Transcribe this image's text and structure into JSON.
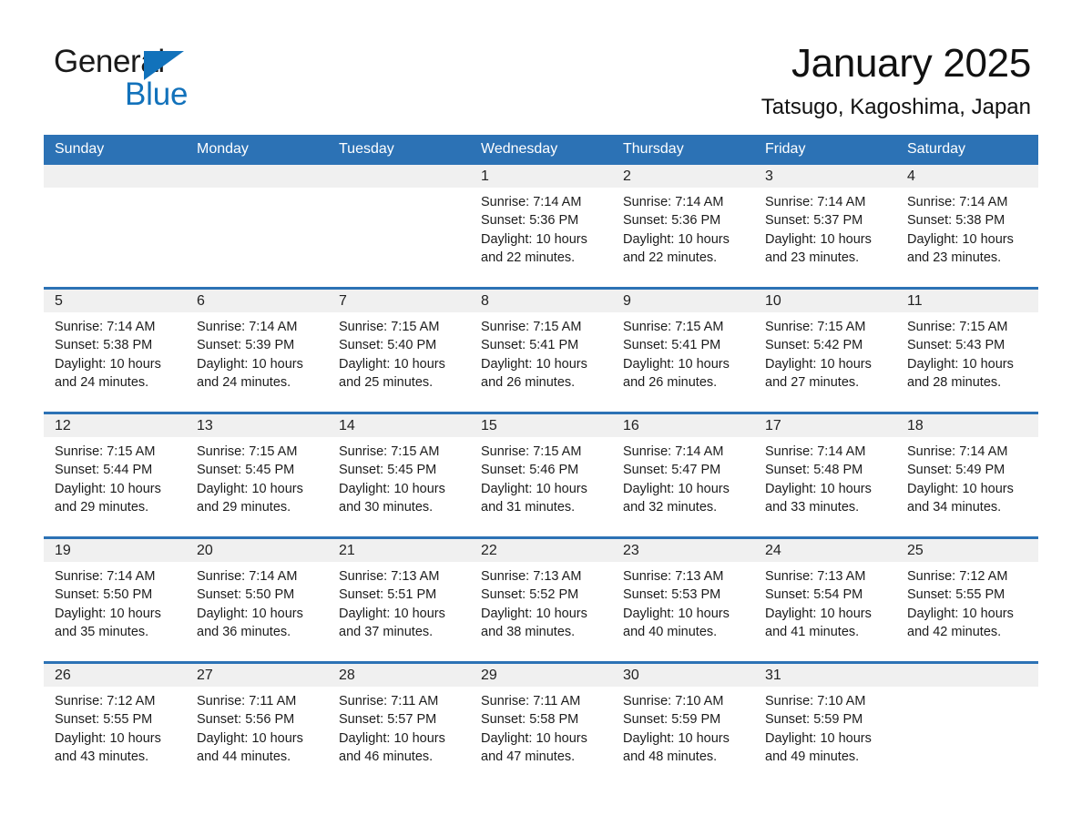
{
  "brand": {
    "word_one": "General",
    "word_two": "Blue",
    "accent_color": "#1272bb"
  },
  "header": {
    "month_title": "January 2025",
    "location": "Tatsugo, Kagoshima, Japan",
    "header_bg": "#2c72b5"
  },
  "weekday_headers": [
    "Sunday",
    "Monday",
    "Tuesday",
    "Wednesday",
    "Thursday",
    "Friday",
    "Saturday"
  ],
  "weeks": [
    [
      {
        "day": "",
        "details": ""
      },
      {
        "day": "",
        "details": ""
      },
      {
        "day": "",
        "details": ""
      },
      {
        "day": "1",
        "details": "Sunrise: 7:14 AM\nSunset: 5:36 PM\nDaylight: 10 hours\nand 22 minutes."
      },
      {
        "day": "2",
        "details": "Sunrise: 7:14 AM\nSunset: 5:36 PM\nDaylight: 10 hours\nand 22 minutes."
      },
      {
        "day": "3",
        "details": "Sunrise: 7:14 AM\nSunset: 5:37 PM\nDaylight: 10 hours\nand 23 minutes."
      },
      {
        "day": "4",
        "details": "Sunrise: 7:14 AM\nSunset: 5:38 PM\nDaylight: 10 hours\nand 23 minutes."
      }
    ],
    [
      {
        "day": "5",
        "details": "Sunrise: 7:14 AM\nSunset: 5:38 PM\nDaylight: 10 hours\nand 24 minutes."
      },
      {
        "day": "6",
        "details": "Sunrise: 7:14 AM\nSunset: 5:39 PM\nDaylight: 10 hours\nand 24 minutes."
      },
      {
        "day": "7",
        "details": "Sunrise: 7:15 AM\nSunset: 5:40 PM\nDaylight: 10 hours\nand 25 minutes."
      },
      {
        "day": "8",
        "details": "Sunrise: 7:15 AM\nSunset: 5:41 PM\nDaylight: 10 hours\nand 26 minutes."
      },
      {
        "day": "9",
        "details": "Sunrise: 7:15 AM\nSunset: 5:41 PM\nDaylight: 10 hours\nand 26 minutes."
      },
      {
        "day": "10",
        "details": "Sunrise: 7:15 AM\nSunset: 5:42 PM\nDaylight: 10 hours\nand 27 minutes."
      },
      {
        "day": "11",
        "details": "Sunrise: 7:15 AM\nSunset: 5:43 PM\nDaylight: 10 hours\nand 28 minutes."
      }
    ],
    [
      {
        "day": "12",
        "details": "Sunrise: 7:15 AM\nSunset: 5:44 PM\nDaylight: 10 hours\nand 29 minutes."
      },
      {
        "day": "13",
        "details": "Sunrise: 7:15 AM\nSunset: 5:45 PM\nDaylight: 10 hours\nand 29 minutes."
      },
      {
        "day": "14",
        "details": "Sunrise: 7:15 AM\nSunset: 5:45 PM\nDaylight: 10 hours\nand 30 minutes."
      },
      {
        "day": "15",
        "details": "Sunrise: 7:15 AM\nSunset: 5:46 PM\nDaylight: 10 hours\nand 31 minutes."
      },
      {
        "day": "16",
        "details": "Sunrise: 7:14 AM\nSunset: 5:47 PM\nDaylight: 10 hours\nand 32 minutes."
      },
      {
        "day": "17",
        "details": "Sunrise: 7:14 AM\nSunset: 5:48 PM\nDaylight: 10 hours\nand 33 minutes."
      },
      {
        "day": "18",
        "details": "Sunrise: 7:14 AM\nSunset: 5:49 PM\nDaylight: 10 hours\nand 34 minutes."
      }
    ],
    [
      {
        "day": "19",
        "details": "Sunrise: 7:14 AM\nSunset: 5:50 PM\nDaylight: 10 hours\nand 35 minutes."
      },
      {
        "day": "20",
        "details": "Sunrise: 7:14 AM\nSunset: 5:50 PM\nDaylight: 10 hours\nand 36 minutes."
      },
      {
        "day": "21",
        "details": "Sunrise: 7:13 AM\nSunset: 5:51 PM\nDaylight: 10 hours\nand 37 minutes."
      },
      {
        "day": "22",
        "details": "Sunrise: 7:13 AM\nSunset: 5:52 PM\nDaylight: 10 hours\nand 38 minutes."
      },
      {
        "day": "23",
        "details": "Sunrise: 7:13 AM\nSunset: 5:53 PM\nDaylight: 10 hours\nand 40 minutes."
      },
      {
        "day": "24",
        "details": "Sunrise: 7:13 AM\nSunset: 5:54 PM\nDaylight: 10 hours\nand 41 minutes."
      },
      {
        "day": "25",
        "details": "Sunrise: 7:12 AM\nSunset: 5:55 PM\nDaylight: 10 hours\nand 42 minutes."
      }
    ],
    [
      {
        "day": "26",
        "details": "Sunrise: 7:12 AM\nSunset: 5:55 PM\nDaylight: 10 hours\nand 43 minutes."
      },
      {
        "day": "27",
        "details": "Sunrise: 7:11 AM\nSunset: 5:56 PM\nDaylight: 10 hours\nand 44 minutes."
      },
      {
        "day": "28",
        "details": "Sunrise: 7:11 AM\nSunset: 5:57 PM\nDaylight: 10 hours\nand 46 minutes."
      },
      {
        "day": "29",
        "details": "Sunrise: 7:11 AM\nSunset: 5:58 PM\nDaylight: 10 hours\nand 47 minutes."
      },
      {
        "day": "30",
        "details": "Sunrise: 7:10 AM\nSunset: 5:59 PM\nDaylight: 10 hours\nand 48 minutes."
      },
      {
        "day": "31",
        "details": "Sunrise: 7:10 AM\nSunset: 5:59 PM\nDaylight: 10 hours\nand 49 minutes."
      },
      {
        "day": "",
        "details": ""
      }
    ]
  ]
}
